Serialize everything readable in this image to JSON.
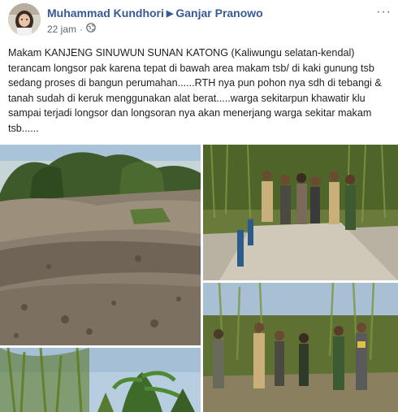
{
  "post": {
    "author": "Muhammad Kundhori",
    "recipient": "Ganjar Pranowo",
    "timestamp": "22 jam",
    "separator": "·",
    "more_label": "···",
    "text": "Makam KANJENG SINUWUN SUNAN KATONG (Kaliwungu selatan-kendal) terancam longsor pak karena tepat di bawah area makam tsb/ di kaki gunung tsb sedang proses di bangun perumahan......RTH nya pun pohon nya sdh di tebangi & tanah sudah di keruk menggunakan alat berat.....warga sekitarpun khawatir klu sampai terjadi longsor dan longsoran nya akan menerjang warga sekitar makam tsb......"
  },
  "colors": {
    "link": "#385898",
    "meta": "#606770",
    "text": "#1c1e21"
  },
  "icons": {
    "privacy": "globe-icon",
    "recipient_arrow": "triangle-right-icon",
    "options": "more-options-icon"
  }
}
